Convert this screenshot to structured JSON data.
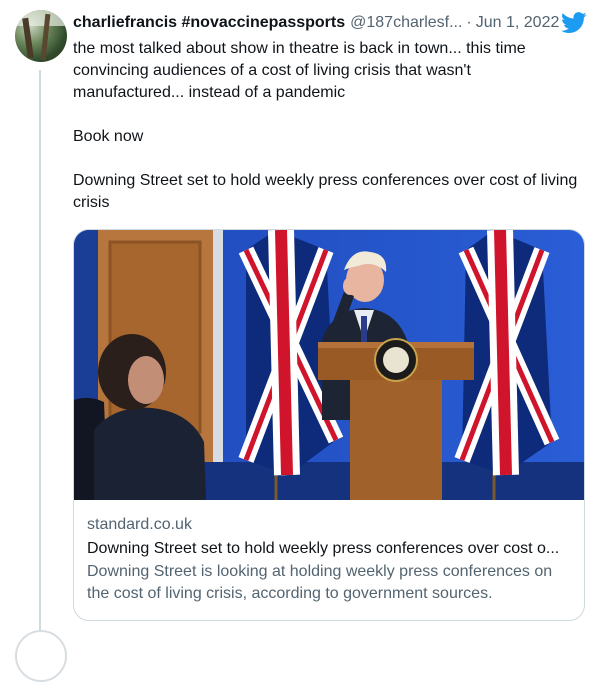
{
  "tweet": {
    "author_name": "charliefrancis #novaccinepassports",
    "author_handle": "@187charlesf...",
    "separator": "·",
    "date": "Jun 1, 2022",
    "text_paragraphs": [
      "the most talked about show in theatre is back in town... this time convincing audiences of a cost of living crisis that wasn't manufactured... instead of a pandemic",
      "Book now",
      "Downing Street set to hold weekly press conferences over cost of living crisis"
    ]
  },
  "link_card": {
    "domain": "standard.co.uk",
    "title": "Downing Street set to hold weekly press conferences over cost o...",
    "description": "Downing Street is looking at holding weekly press conferences on the cost of living crisis, according to government sources."
  },
  "icons": {
    "brand": "twitter-bird-icon"
  },
  "colors": {
    "brand_blue": "#1d9bf0",
    "muted_text": "#536471",
    "border": "#cfd9de"
  }
}
